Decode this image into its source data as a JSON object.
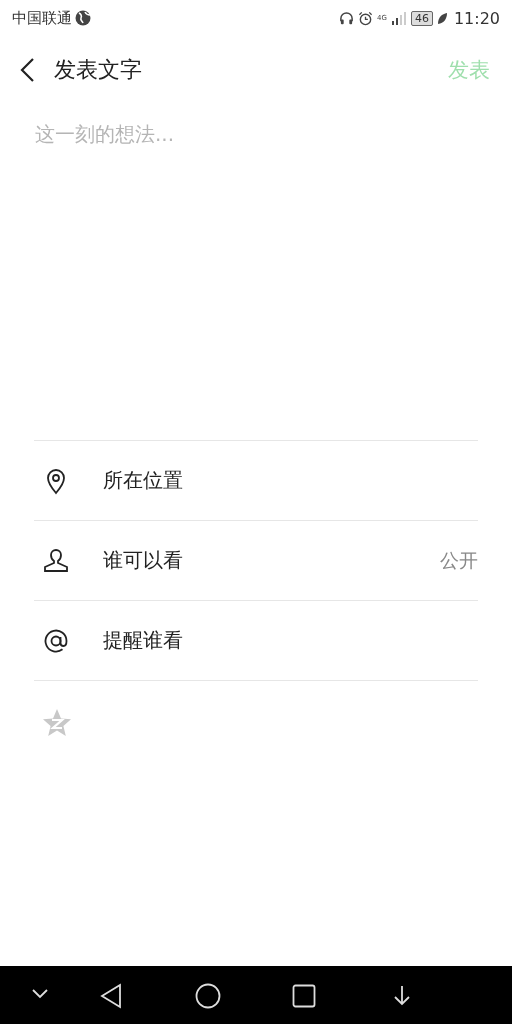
{
  "status_bar": {
    "carrier": "中国联通",
    "network": "4G",
    "battery": "46",
    "time": "11:20"
  },
  "header": {
    "title": "发表文字",
    "publish": {
      "label": "发表",
      "disabled": true
    }
  },
  "composer": {
    "placeholder": "这一刻的想法..."
  },
  "options": [
    {
      "kind": "location",
      "label": "所在位置"
    },
    {
      "kind": "visibility",
      "label": "谁可以看",
      "value": "公开"
    },
    {
      "kind": "mention",
      "label": "提醒谁看"
    }
  ]
}
